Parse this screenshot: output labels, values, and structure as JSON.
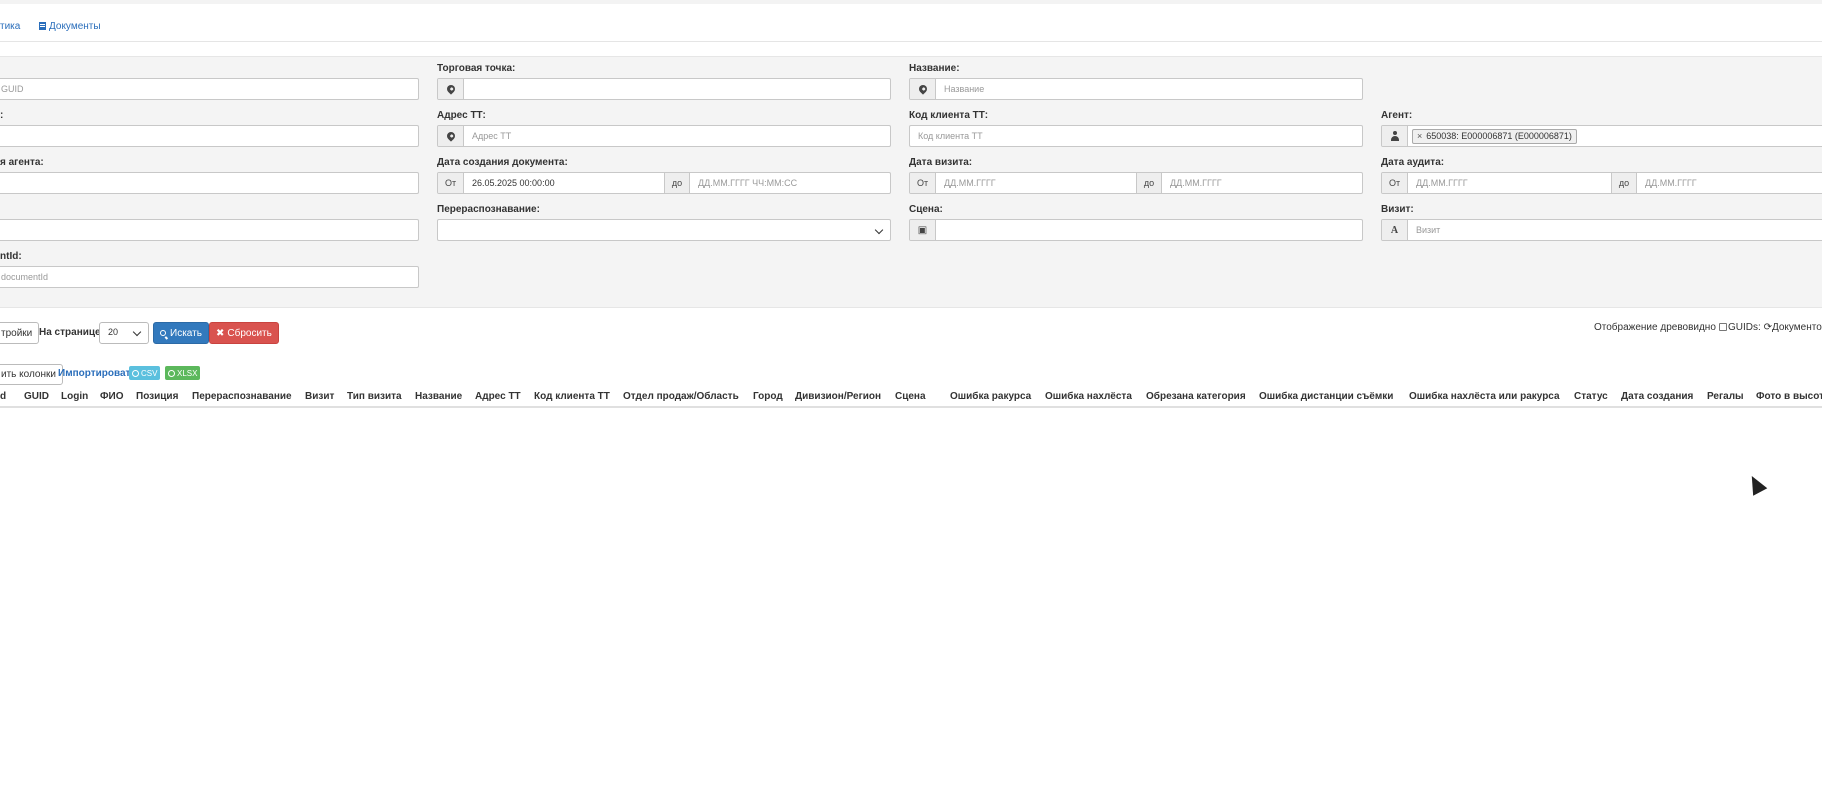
{
  "nav": {
    "analytics_label": "тика",
    "documents_label": "Документы"
  },
  "filters": {
    "guid": {
      "label": "",
      "placeholder": "GUID",
      "value": ""
    },
    "outlet": {
      "label": "Торговая точка:",
      "value": ""
    },
    "name": {
      "label": "Название:",
      "placeholder": "Название",
      "value": ""
    },
    "row2_col1": {
      "label": ":",
      "value": ""
    },
    "tt_address": {
      "label": "Адрес ТТ:",
      "placeholder": "Адрес ТТ",
      "value": ""
    },
    "tt_client_code": {
      "label": "Код клиента ТТ:",
      "placeholder": "Код клиента ТТ",
      "value": ""
    },
    "agent": {
      "label": "Агент:",
      "tag": "650038: E000006871 (E000006871)",
      "tag_remove": "×"
    },
    "agent_name": {
      "label": "я агента:",
      "value": ""
    },
    "doc_created": {
      "label": "Дата создания документа:",
      "from_label": "От",
      "from_value": "26.05.2025 00:00:00",
      "to_label": "до",
      "to_placeholder": "ДД.ММ.ГГГГ ЧЧ:ММ:СС"
    },
    "visit_date": {
      "label": "Дата визита:",
      "from_label": "От",
      "from_placeholder": "ДД.ММ.ГГГГ",
      "to_label": "до",
      "to_placeholder": "ДД.ММ.ГГГГ"
    },
    "audit_date": {
      "label": "Дата аудита:",
      "from_label": "От",
      "from_placeholder": "ДД.ММ.ГГГГ",
      "to_label": "до",
      "to_placeholder": "ДД.ММ.ГГГГ"
    },
    "row4_col1": {
      "value": ""
    },
    "rerecognition": {
      "label": "Перераспознавание:",
      "value": ""
    },
    "scene": {
      "label": "Сцена:",
      "value": ""
    },
    "visit": {
      "label": "Визит:",
      "placeholder": "Визит",
      "value": ""
    },
    "document_id": {
      "label": "ntId:",
      "placeholder": "documentId",
      "value": ""
    }
  },
  "controls": {
    "settings_label": "тройки",
    "per_page_label": "На странице:",
    "per_page_value": "20",
    "search_label": "Искать",
    "reset_label": "Сбросить",
    "tree_view_label": "Отображение древовидно",
    "guids_label": "GUIDs:",
    "documents_refresh_label": "Документов"
  },
  "actions": {
    "columns_label": "ить колонки",
    "import_label": "Импортировать",
    "csv_label": "CSV",
    "xlsx_label": "XLSX"
  },
  "table": {
    "columns": [
      "d",
      "GUID",
      "Login",
      "ФИО",
      "Позиция",
      "Перераспознавание",
      "Визит",
      "Тип визита",
      "Название",
      "Адрес ТТ",
      "Код клиента ТТ",
      "Отдел продаж/Область",
      "Город",
      "Дивизион/Регион",
      "Сцена",
      "Ошибка ракурса",
      "Ошибка нахлёста",
      "Обрезана категория",
      "Ошибка дистанции съёмки",
      "Ошибка нахлёста или ракурса",
      "Статус",
      "Дата создания",
      "Регалы",
      "Фото в высоту"
    ]
  },
  "colors": {
    "primary": "#3279bd",
    "danger": "#d9534f",
    "info": "#5bc0de",
    "success": "#5cb85c",
    "link": "#2a6ebb"
  }
}
